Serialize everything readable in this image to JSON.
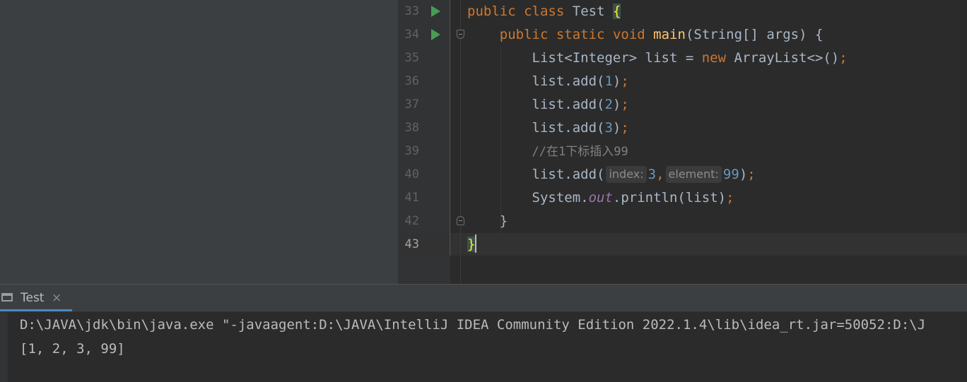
{
  "editor": {
    "lines": [
      {
        "num": "33",
        "tokens": {
          "kw1": "public",
          "kw2": "class",
          "name": "Test",
          "brace": "{"
        }
      },
      {
        "num": "34",
        "tokens": {
          "kw1": "public",
          "kw2": "static",
          "kw3": "void",
          "fn": "main",
          "params": "(String[] args) {"
        }
      },
      {
        "num": "35",
        "tokens": {
          "a": "List<Integer> list = ",
          "kw": "new",
          "b": " ArrayList<>()",
          "semi": ";"
        }
      },
      {
        "num": "36",
        "tokens": {
          "a": "list.add(",
          "n": "1",
          "b": ")",
          "semi": ";"
        }
      },
      {
        "num": "37",
        "tokens": {
          "a": "list.add(",
          "n": "2",
          "b": ")",
          "semi": ";"
        }
      },
      {
        "num": "38",
        "tokens": {
          "a": "list.add(",
          "n": "3",
          "b": ")",
          "semi": ";"
        }
      },
      {
        "num": "39",
        "tokens": {
          "comment": "//在1下标插入99"
        }
      },
      {
        "num": "40",
        "tokens": {
          "a": "list.add(",
          "hint1": "index:",
          "n1": "3",
          "comma": ",",
          "hint2": "element:",
          "n2": "99",
          "b": ")",
          "semi": ";"
        }
      },
      {
        "num": "41",
        "tokens": {
          "a": "System.",
          "field": "out",
          "b": ".println(list)",
          "semi": ";"
        }
      },
      {
        "num": "42",
        "tokens": {
          "brace": "}"
        }
      },
      {
        "num": "43",
        "tokens": {
          "brace": "}"
        }
      }
    ]
  },
  "run_panel": {
    "tab_label": "Test",
    "close_glyph": "×",
    "console_lines": [
      "D:\\JAVA\\jdk\\bin\\java.exe \"-javaagent:D:\\JAVA\\IntelliJ IDEA Community Edition 2022.1.4\\lib\\idea_rt.jar=50052:D:\\J",
      "[1, 2, 3, 99]"
    ]
  },
  "colors": {
    "keyword": "#cc7832",
    "function": "#ffc66d",
    "number": "#6897bb",
    "comment": "#808080",
    "static_field": "#9876aa",
    "run_icon": "#499c54"
  }
}
